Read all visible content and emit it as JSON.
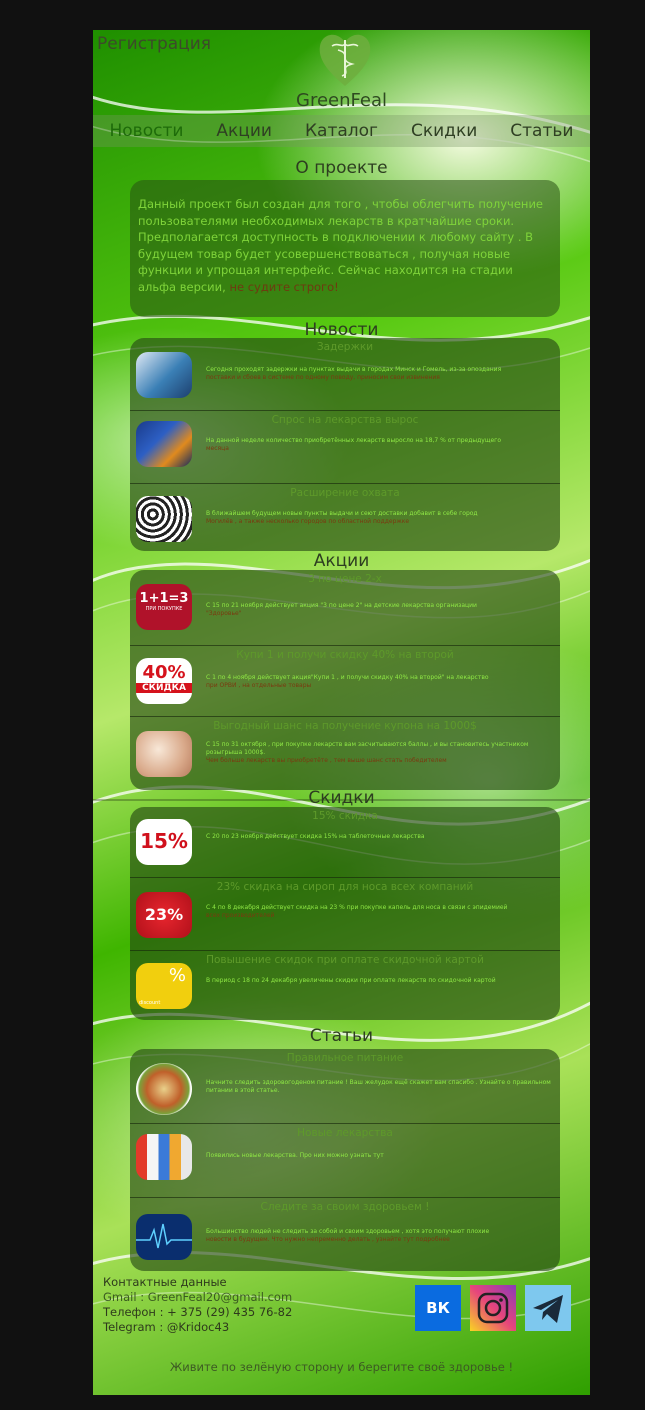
{
  "header": {
    "register_label": "Регистрация",
    "brand": "GreenFeal",
    "logo_icon": "heart-caduceus-icon"
  },
  "nav": {
    "items": [
      {
        "label": "Новости",
        "active": true
      },
      {
        "label": "Акции",
        "active": false
      },
      {
        "label": "Каталог",
        "active": false
      },
      {
        "label": "Скидки",
        "active": false
      },
      {
        "label": "Статьи",
        "active": false
      }
    ]
  },
  "about": {
    "title": "О проекте",
    "text": "Данный проект был создан для того , чтобы облегчить получение пользователями необходимых лекарств в кратчайшие сроки. Предполагается доступность в подключении к любому сайту . В будущем товар будет усовершенствоваться , получая новые функции и упрощая интерфейс. Сейчас находится на стадии альфа версии,",
    "text_dim": "не судите строго!"
  },
  "news": {
    "title": "Новости",
    "items": [
      {
        "title": "Задержки",
        "text": "Сегодня проходят задержки на пунктах выдачи в городах Минск и Гомель, из-за опоздания",
        "text_dim": "поставки и сбоев в системе по одному поводу, приносим свои извинения"
      },
      {
        "title": "Спрос на лекарства вырос",
        "text": "На данной неделе количество приобретённых лекарств выросло на 18,7 % от предыдущего",
        "text_dim": "месяца"
      },
      {
        "title": "Расширение охвата",
        "text": "В ближайшем будущем новые пункты выдачи и сеют доставки добавит в себе город",
        "text_dim": "Могилёв , а также несколько городов по областной поддержке"
      }
    ]
  },
  "promos": {
    "title": "Акции",
    "items": [
      {
        "title": "3 по цене 2-х",
        "text": "С 15 по 21 ноября действует акция \"3 по цене 2\" на детские лекарства организации",
        "text_dim": "\"Здоровье\""
      },
      {
        "title": "Купи 1 и получи скидку 40% на второй",
        "text": "С 1 по 4 ноября действует акция\"Купи 1 , и получи скидку 40% на второй\" на лекарство",
        "text_dim": "при ОРВИ , на отдельные товары"
      },
      {
        "title": "Выгодный шанс на получение купона на 1000$",
        "text": "С 15 по 31 октября , при покупке лекарств вам засчитываются баллы , и вы становитесь участником розыгрыша 1000$.",
        "text_dim": "Чем больше лекарств вы приобретёте , тем выше шанс стать победителем"
      }
    ]
  },
  "discounts": {
    "title": "Скидки",
    "items": [
      {
        "title": "15% скидка",
        "text": "С 20 по 23 ноября действует скидка 15% на таблеточные лекарства",
        "text_dim": ""
      },
      {
        "title": "23% скидка на сироп для носа всех компаний",
        "text": "С 4 по 8 декабря действует скидка на 23 % при покупке капель для носа в связи с эпидемией",
        "text_dim": "всех производителей"
      },
      {
        "title": "Повышение скидок при оплате скидочной картой",
        "text": "В период с 18 по 24 декабря увеличены скидки при оплате лекарств по скидочной картой",
        "text_dim": ""
      }
    ]
  },
  "articles": {
    "title": "Статьи",
    "items": [
      {
        "title": "Правильное питание",
        "text": "Начните следить здоровогоденом питание ! Ваш желудок ещё скажет вам спасибо . Узнайте о правильном питании в этой статье.",
        "text_dim": ""
      },
      {
        "title": "Новые лекарства",
        "text": "Появились новые лекарства. Про них можно узнать тут",
        "text_dim": ""
      },
      {
        "title": "Следите за своим здоровьем !",
        "text": "Большинство людей не следить за собой и своим здоровьем , хотя это получают плохие",
        "text_dim": "новости в будущем. Что нужно непременно делать , узнайте тут подробнее"
      }
    ]
  },
  "footer": {
    "contacts_title": "Контактные данные",
    "email": "Gmail : GreenFeal20@gmail.com",
    "phone": "Телефон : + 375 (29) 435 76-82",
    "telegram": "Telegram : @Kridoc43",
    "slogan": "Живите по зелёную сторону и берегите своё здоровье !",
    "social": [
      {
        "icon": "vk-icon",
        "label": "ВК",
        "color": "#0a6be0"
      },
      {
        "icon": "instagram-icon",
        "color": "#e6457c"
      },
      {
        "icon": "telegram-icon",
        "color": "#2aa3df"
      }
    ]
  },
  "thumb_texts": {
    "promo1_line1": "1+1=3",
    "promo1_line2": "ПРИ ПОКУПКЕ",
    "promo2_top": "40%",
    "promo2_bottom": "СКИДКА",
    "disc1": "15%",
    "disc2": "23%",
    "disc3": "discount"
  }
}
